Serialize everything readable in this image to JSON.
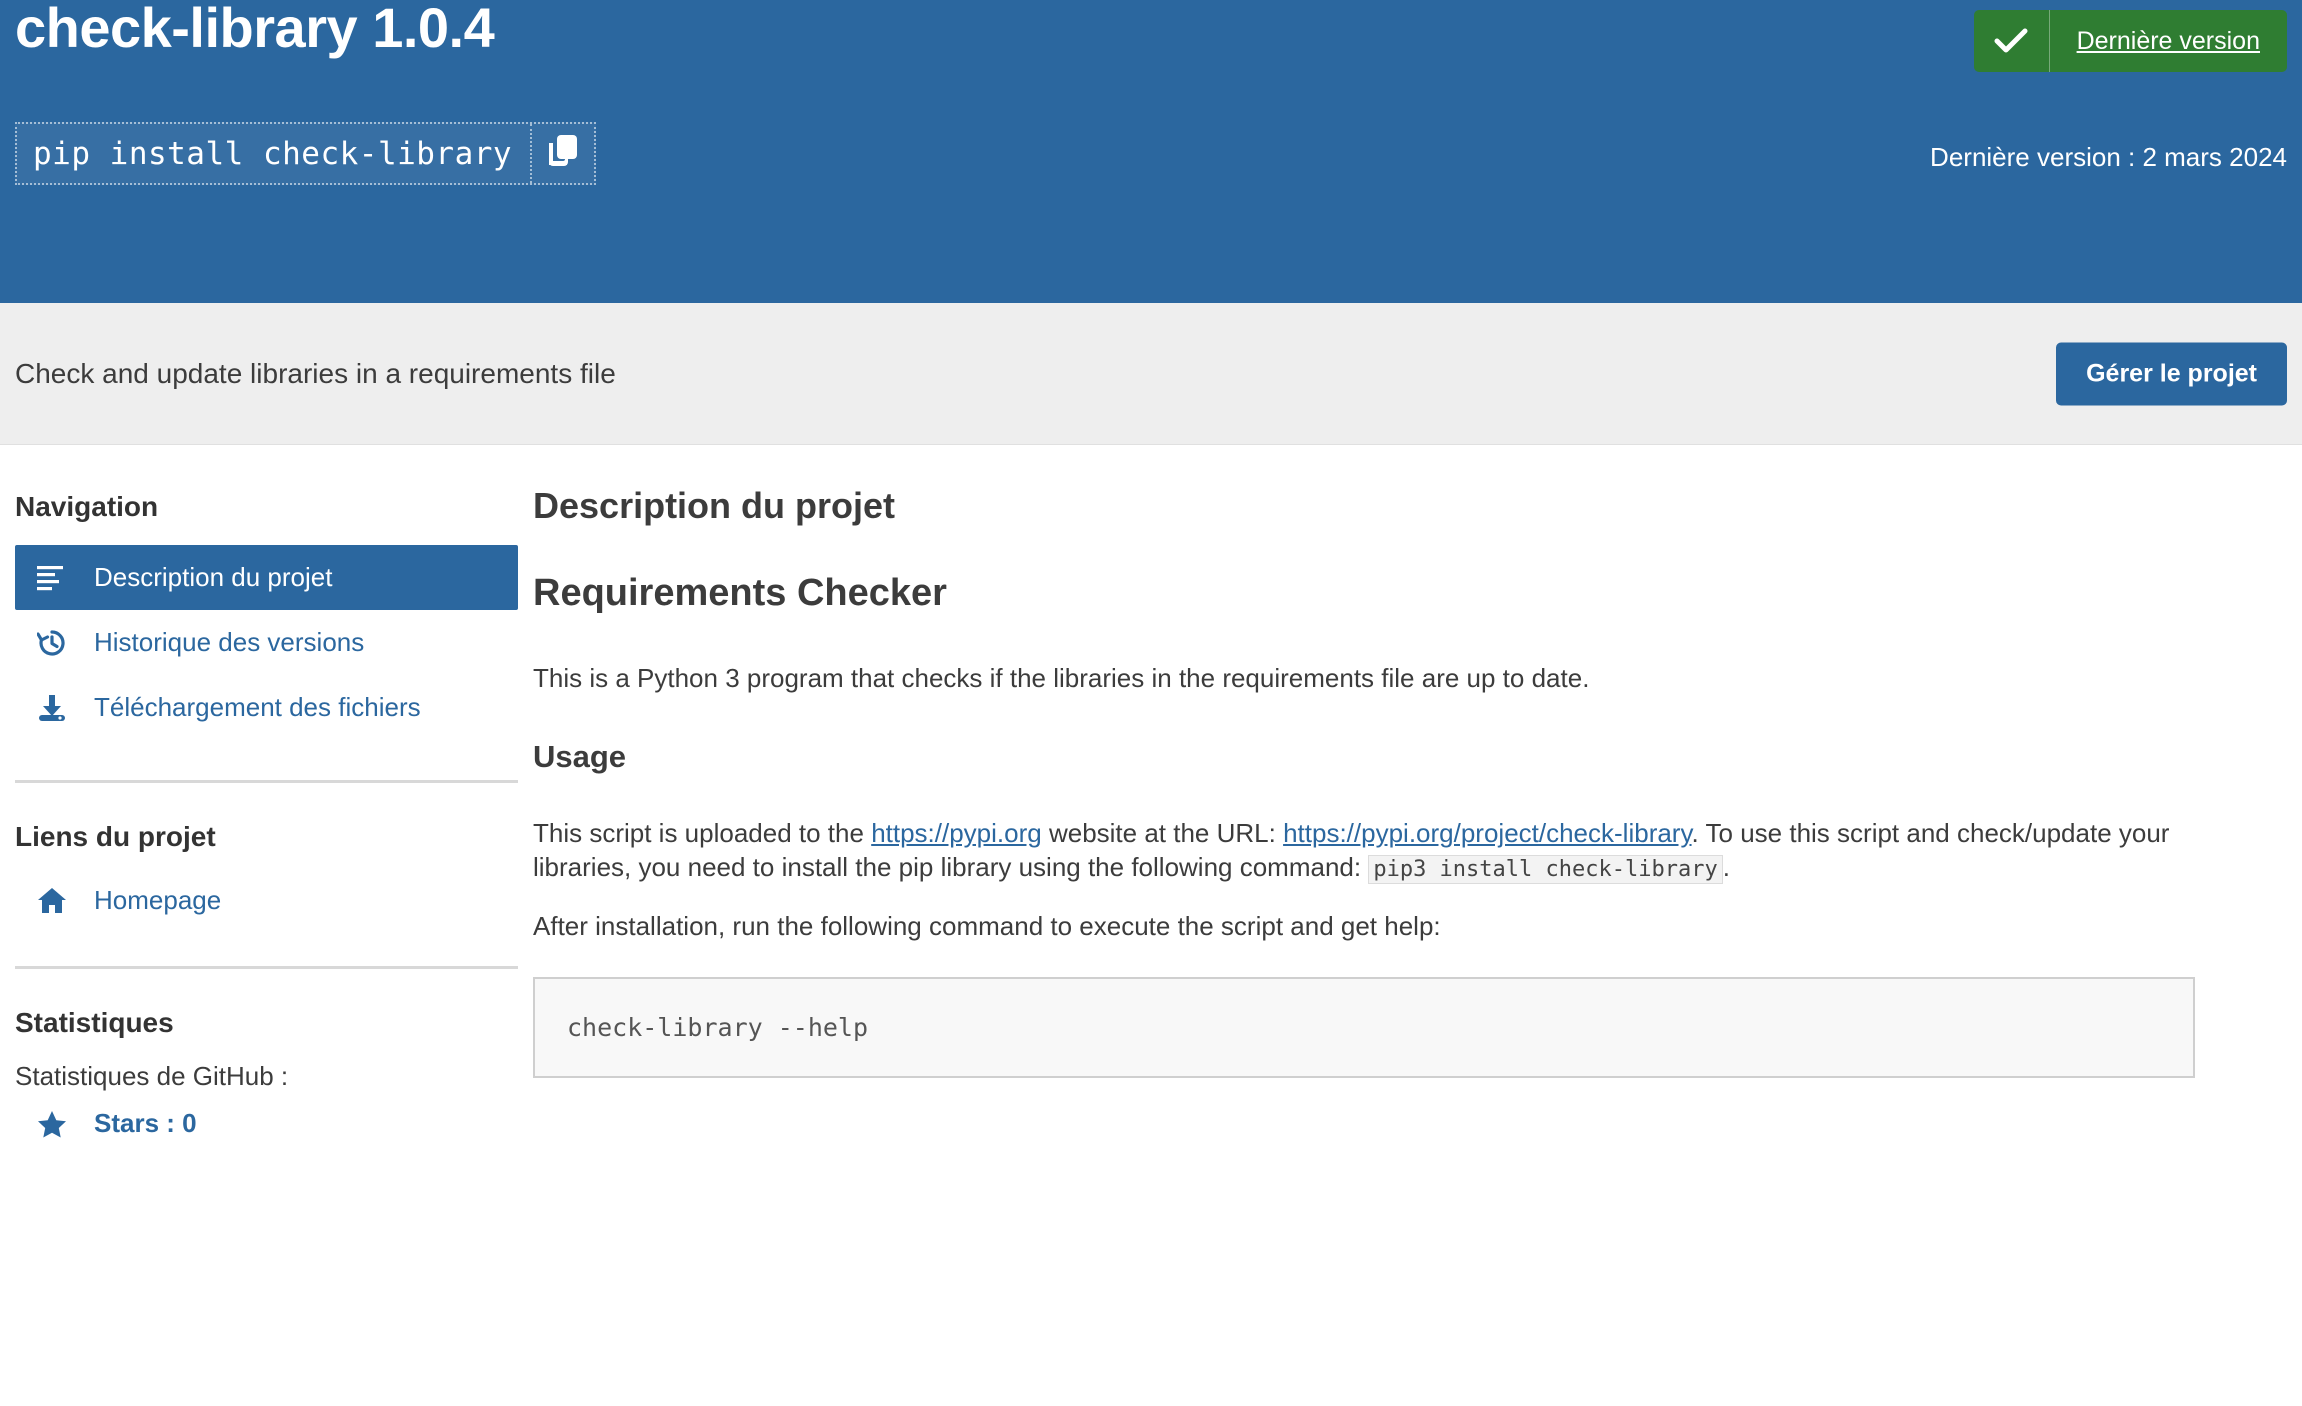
{
  "banner": {
    "title": "check-library 1.0.4",
    "pip_command": "pip install check-library",
    "copy_icon": "copy-icon",
    "badge": {
      "check_icon": "check-icon",
      "label": "Dernière version"
    },
    "last_release": "Dernière version : 2 mars 2024"
  },
  "subheader": {
    "description": "Check and update libraries in a requirements file",
    "manage_button": "Gérer le projet"
  },
  "sidebar": {
    "navigation_heading": "Navigation",
    "nav_items": [
      {
        "label": "Description du projet",
        "icon": "list-icon",
        "active": true
      },
      {
        "label": "Historique des versions",
        "icon": "history-icon",
        "active": false
      },
      {
        "label": "Téléchargement des fichiers",
        "icon": "download-icon",
        "active": false
      }
    ],
    "links_heading": "Liens du projet",
    "links": [
      {
        "label": "Homepage",
        "icon": "home-icon"
      }
    ],
    "stats_heading": "Statistiques",
    "stats_label": "Statistiques de GitHub :",
    "stats": [
      {
        "label": "Stars : 0",
        "icon": "star-icon"
      }
    ]
  },
  "main": {
    "title": "Description du projet",
    "readme_heading": "Requirements Checker",
    "intro": "This is a Python 3 program that checks if the libraries in the requirements file are up to date.",
    "usage_heading": "Usage",
    "usage_p1_part1": "This script is uploaded to the ",
    "usage_link1": "https://pypi.org",
    "usage_p1_part2": " website at the URL: ",
    "usage_link2": "https://pypi.org/project/check-library",
    "usage_p1_part3": ". To use this script and check/update your libraries, you need to install the pip library using the following command: ",
    "usage_code_inline": "pip3 install check-library",
    "usage_p1_part4": ".",
    "after_install": "After installation, run the following command to execute the script and get help:",
    "code_block": "check-library --help"
  },
  "colors": {
    "brand_blue": "#2b679f",
    "badge_green": "#2f7d32",
    "subheader_gray": "#eeeeee",
    "code_bg": "#f8f8f8"
  }
}
